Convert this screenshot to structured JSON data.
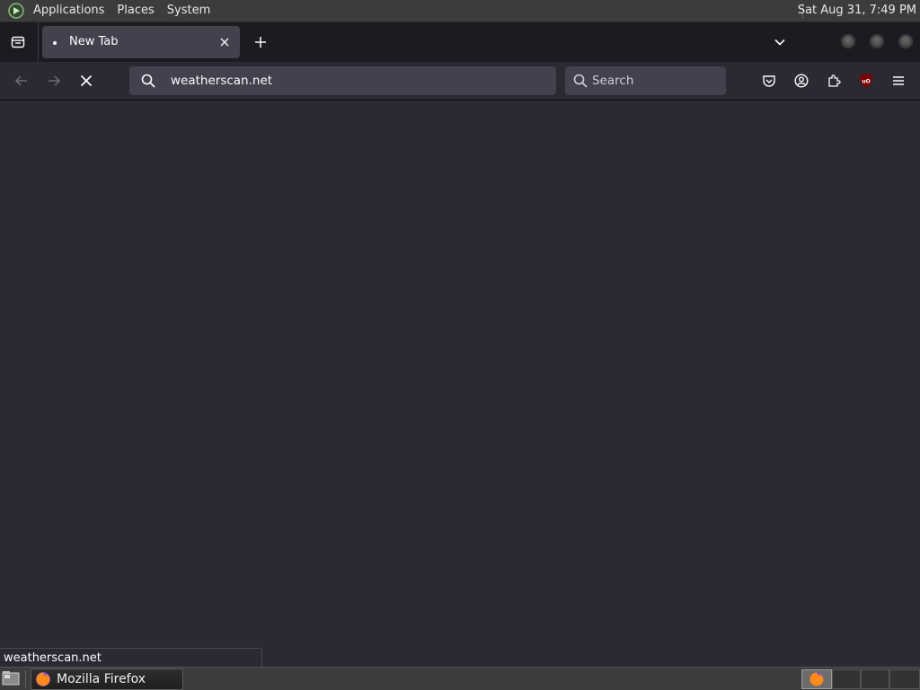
{
  "system_bar": {
    "menus": [
      "Applications",
      "Places",
      "System"
    ],
    "clock": "Sat Aug 31,  7:49 PM"
  },
  "tabs": [
    {
      "title": "New Tab",
      "loading": true
    }
  ],
  "navigation": {
    "url": "weatherscan.net",
    "search_placeholder": "Search"
  },
  "status_panel": {
    "text": "weatherscan.net"
  },
  "taskbar": {
    "task_label": "Mozilla Firefox"
  },
  "colors": {
    "accent_ublock": "#800000",
    "content_bg": "#2b2a33"
  }
}
